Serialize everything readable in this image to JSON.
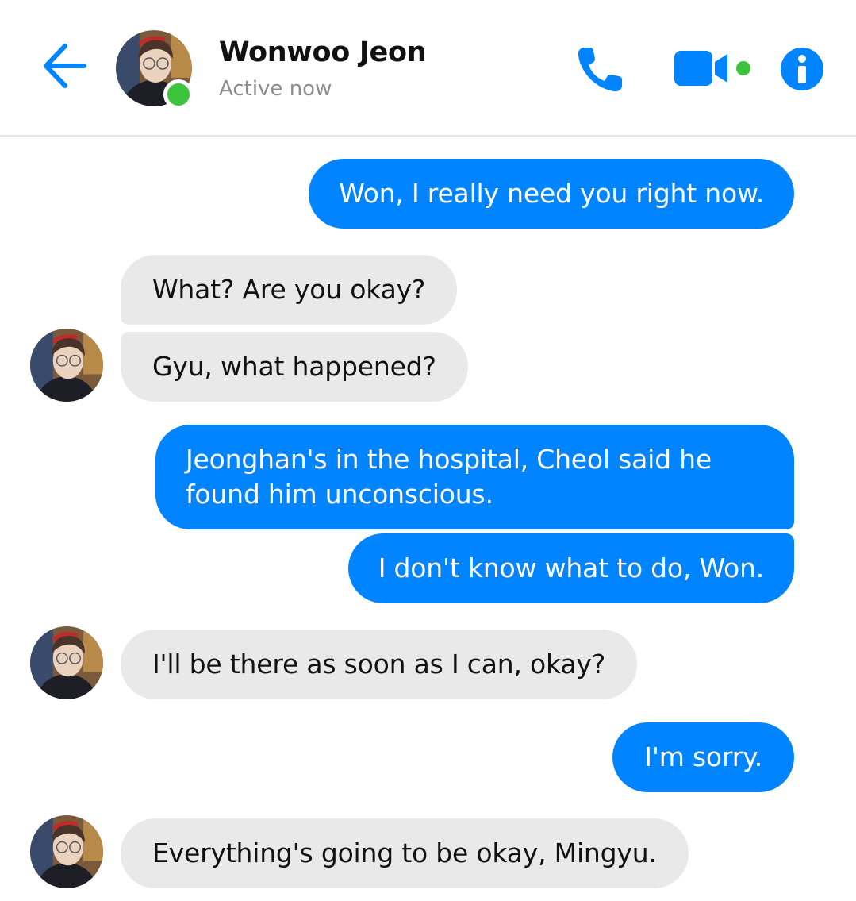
{
  "header": {
    "contact_name": "Wonwoo Jeon",
    "status": "Active now",
    "back_icon": "arrow-left-icon",
    "call_icon": "phone-icon",
    "video_icon": "video-camera-icon",
    "info_icon": "info-icon",
    "accent_color": "#0084ff",
    "online_color": "#3cc43c"
  },
  "messages": [
    {
      "direction": "outgoing",
      "text": "Won, I really need you right now."
    },
    {
      "direction": "incoming",
      "text": "What? Are you okay?"
    },
    {
      "direction": "incoming",
      "text": "Gyu, what happened?"
    },
    {
      "direction": "outgoing",
      "text": "Jeonghan's in the hospital, Cheol said he found him unconscious."
    },
    {
      "direction": "outgoing",
      "text": "I don't know what to do, Won."
    },
    {
      "direction": "incoming",
      "text": "I'll be there as soon as I can, okay?"
    },
    {
      "direction": "outgoing",
      "text": "I'm sorry."
    },
    {
      "direction": "incoming",
      "text": "Everything's going to be okay, Mingyu."
    }
  ],
  "colors": {
    "outgoing_bubble": "#0084ff",
    "incoming_bubble": "#e9e9e9"
  }
}
